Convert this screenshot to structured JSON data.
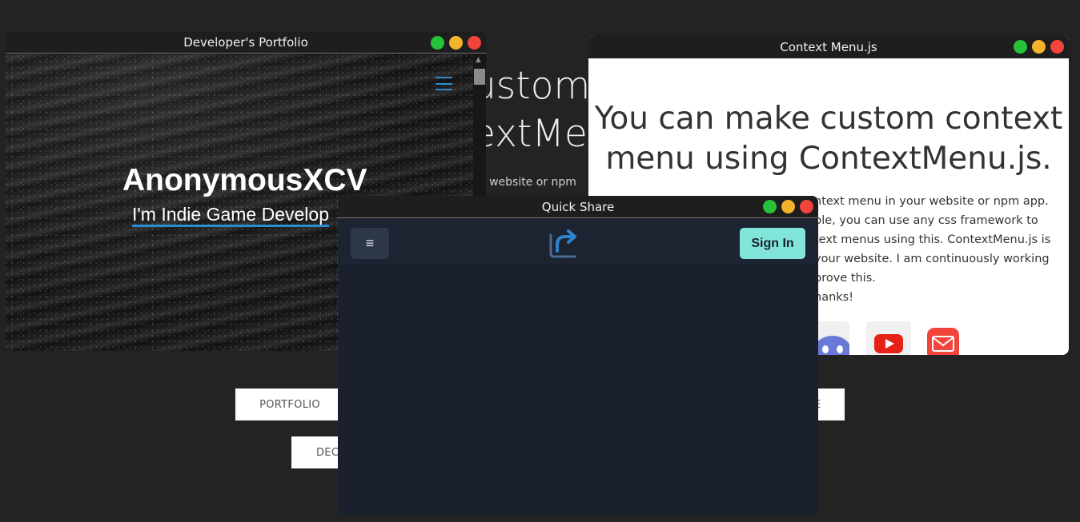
{
  "background": {
    "heading_line1": "ustom",
    "heading_line2": "extMe",
    "subtext": "ur website or npm",
    "buttons": [
      {
        "label": "PORTFOLIO"
      },
      {
        "label": "DEC"
      },
      {
        "label": "E"
      }
    ]
  },
  "portfolio_window": {
    "title": "Developer's Portfolio",
    "name": "AnonymousXCV",
    "tagline": "I'm Indie Game Develop",
    "icons": [
      "hamburger-menu-icon"
    ],
    "accent_color": "#2a8dd2"
  },
  "context_window": {
    "title": "Context Menu.js",
    "heading": "You can make custom context menu using ContextMenu.js.",
    "body_lines": [
      "ntext menu in your website or npm app.",
      "ple, you can use any css framework to",
      "text menus using this. ContextMenu.js is",
      "your website. I am continuously working",
      "prove this.",
      "hanks!"
    ],
    "social_icons": [
      "discord-icon",
      "youtube-icon",
      "mail-icon"
    ]
  },
  "quickshare_window": {
    "title": "Quick Share",
    "menu_glyph": "≡",
    "signin_label": "Sign In",
    "accent_color": "#81e6d9",
    "logo_color": "#3182ce"
  },
  "window_controls": {
    "colors": {
      "green": "#27c23a",
      "yellow": "#f4b32c",
      "red": "#f2443a"
    }
  }
}
